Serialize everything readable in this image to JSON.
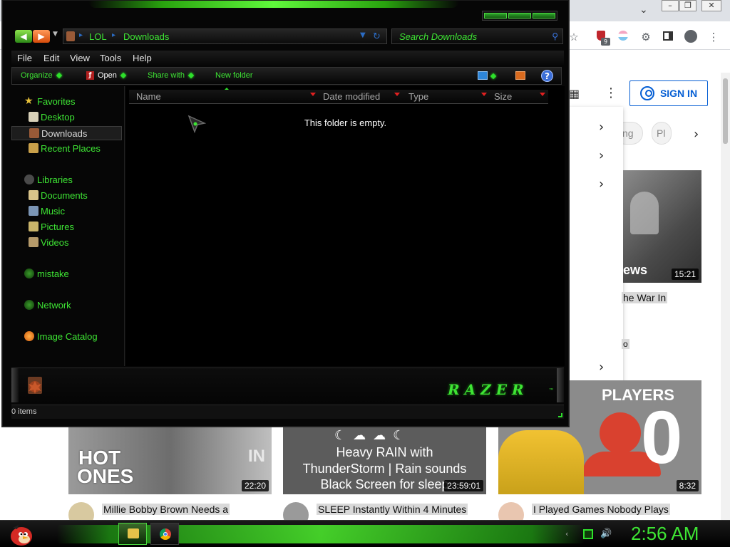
{
  "browser": {
    "extension_badge": "9",
    "sign_in_label": "SIGN IN",
    "chips": [
      "ng",
      "Pl"
    ],
    "top_video": {
      "duration": "15:21",
      "title_fragment": "he War In",
      "meta_fragment": "o",
      "overlay_text": "ews"
    },
    "players_overlay": "PLAYERS",
    "players_digit": "0",
    "videos": [
      {
        "title": "Millie Bobby Brown Needs a",
        "duration": "22:20",
        "overlay_line1": "HOT",
        "overlay_line2": "ONES",
        "overlay_side": "IN"
      },
      {
        "title": "SLEEP Instantly Within 4 Minutes",
        "duration": "23:59:01",
        "overlay_lines": [
          "Heavy RAIN with",
          "ThunderStorm | Rain sounds",
          "Black Screen for sleep"
        ]
      },
      {
        "title": "I Played Games Nobody Plays",
        "duration": "8:32"
      }
    ]
  },
  "explorer": {
    "breadcrumb": [
      "LOL",
      "Downloads"
    ],
    "search_placeholder": "Search Downloads",
    "menu": [
      "File",
      "Edit",
      "View",
      "Tools",
      "Help"
    ],
    "commands": {
      "organize": "Organize",
      "open": "Open",
      "share": "Share with",
      "new_folder": "New folder"
    },
    "nav": {
      "favorites": "Favorites",
      "desktop": "Desktop",
      "downloads": "Downloads",
      "recent": "Recent Places",
      "libraries": "Libraries",
      "documents": "Documents",
      "music": "Music",
      "pictures": "Pictures",
      "videos": "Videos",
      "mistake": "mistake",
      "network": "Network",
      "image_catalog": "Image Catalog"
    },
    "columns": [
      "Name",
      "Date modified",
      "Type",
      "Size"
    ],
    "empty_message": "This folder is empty.",
    "brand": "RAZER",
    "brand_tm": "™",
    "status": "0 items"
  },
  "taskbar": {
    "clock": "2:56 AM"
  },
  "colors": {
    "accent_green": "#3ee534",
    "window_bg": "#060606",
    "link_blue": "#065fd4"
  }
}
